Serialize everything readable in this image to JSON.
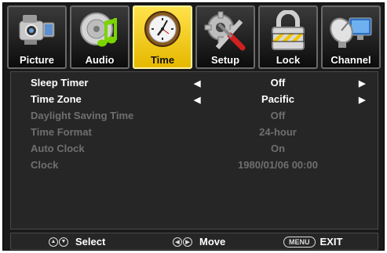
{
  "tabs": [
    {
      "label": "Picture",
      "icon": "camcorder-icon",
      "active": false
    },
    {
      "label": "Audio",
      "icon": "music-note-icon",
      "active": false
    },
    {
      "label": "Time",
      "icon": "clock-icon",
      "active": true
    },
    {
      "label": "Setup",
      "icon": "tools-icon",
      "active": false
    },
    {
      "label": "Lock",
      "icon": "padlock-icon",
      "active": false
    },
    {
      "label": "Channel",
      "icon": "satellite-dish-icon",
      "active": false
    }
  ],
  "settings": [
    {
      "name": "Sleep Timer",
      "value": "Off",
      "enabled": true,
      "has_arrows": true
    },
    {
      "name": "Time Zone",
      "value": "Pacific",
      "enabled": true,
      "has_arrows": true
    },
    {
      "name": "Daylight Saving Time",
      "value": "Off",
      "enabled": false,
      "has_arrows": false
    },
    {
      "name": "Time Format",
      "value": "24-hour",
      "enabled": false,
      "has_arrows": false
    },
    {
      "name": "Auto Clock",
      "value": "On",
      "enabled": false,
      "has_arrows": false
    },
    {
      "name": "Clock",
      "value": "1980/01/06 00:00",
      "enabled": false,
      "has_arrows": false
    }
  ],
  "help": {
    "select": "Select",
    "move": "Move",
    "menu_key": "MENU",
    "exit": "EXIT"
  },
  "colors": {
    "active_tab": "#f5c800",
    "background": "#1a1a1a",
    "disabled_text": "#6f6f6f"
  }
}
